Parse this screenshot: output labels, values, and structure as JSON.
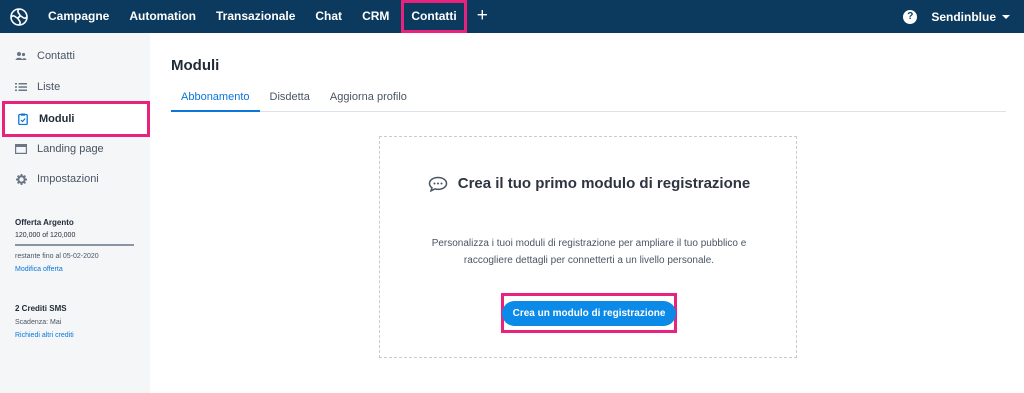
{
  "topnav": {
    "logo_icon": "sendinblue-logo-icon",
    "items": [
      {
        "label": "Campagne"
      },
      {
        "label": "Automation"
      },
      {
        "label": "Transazionale"
      },
      {
        "label": "Chat"
      },
      {
        "label": "CRM"
      },
      {
        "label": "Contatti",
        "active": true
      }
    ],
    "plus_label": "+",
    "help_label": "?",
    "account_label": "Sendinblue"
  },
  "sidebar": {
    "items": [
      {
        "label": "Contatti",
        "icon": "users-icon"
      },
      {
        "label": "Liste",
        "icon": "list-icon"
      },
      {
        "label": "Moduli",
        "icon": "clipboard-icon",
        "active": true
      },
      {
        "label": "Landing page",
        "icon": "browser-window-icon"
      },
      {
        "label": "Impostazioni",
        "icon": "gear-icon"
      }
    ],
    "plan": {
      "title": "Offerta Argento",
      "count": "120,000 of 120,000",
      "remaining_fraction": 1.0,
      "expiry": "restante fino al 05-02-2020",
      "link": "Modifica offerta"
    },
    "sms": {
      "title": "2 Crediti SMS",
      "expiry": "Scadenza: Mai",
      "link": "Richiedi altri crediti"
    }
  },
  "main": {
    "title": "Moduli",
    "tabs": [
      {
        "label": "Abbonamento",
        "active": true
      },
      {
        "label": "Disdetta"
      },
      {
        "label": "Aggiorna profilo"
      }
    ],
    "card": {
      "icon": "chat-bubble-icon",
      "title": "Crea il tuo primo modulo di registrazione",
      "desc_line1": "Personalizza i tuoi moduli di registrazione per ampliare il tuo pubblico e",
      "desc_line2": "raccogliere dettagli per connetterti a un livello personale.",
      "cta": "Crea un modulo di registrazione"
    }
  },
  "colors": {
    "topbar": "#0b3a5e",
    "highlight": "#e8237d",
    "accent": "#0b76d8",
    "cta": "#0b8ae8"
  }
}
